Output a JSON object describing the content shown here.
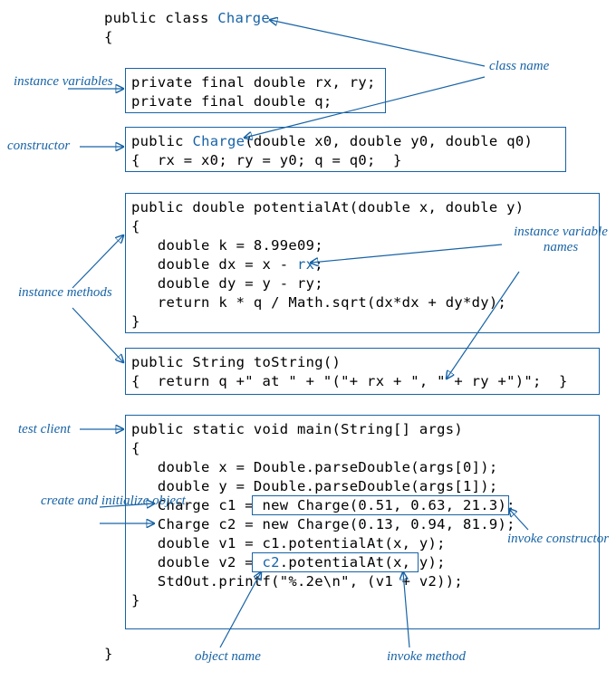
{
  "labels": {
    "class_name": "class\nname",
    "instance_variables": "instance\nvariables",
    "constructor": "constructor",
    "instance_methods": "instance\nmethods",
    "instance_variable_names": "instance\nvariable\nnames",
    "test_client": "test client",
    "create_initialize": "create\nand\ninitialize\nobject",
    "invoke_constructor": "invoke\nconstructor",
    "object_name": "object\nname",
    "invoke_method": "invoke\nmethod"
  },
  "code": {
    "line1a": "public class ",
    "line1b": "Charge",
    "line2": "{",
    "ivar1": "private final double rx, ry;",
    "ivar2": "private final double q;",
    "ctor1a": "public ",
    "ctor1b": "Charge",
    "ctor1c": "(double x0, double y0, double q0)",
    "ctor2": "{  rx = x0; ry = y0; q = q0;  }",
    "pot1": "public double potentialAt(double x, double y)",
    "pot2": "{",
    "pot3": "   double k = 8.99e09;",
    "pot4a": "   double dx = x - ",
    "pot4b": "rx",
    "pot4c": ";",
    "pot5": "   double dy = y - ry;",
    "pot6": "   return k * q / Math.sqrt(dx*dx + dy*dy);",
    "pot7": "}",
    "ts1": "public String toString()",
    "ts2": "{  return q +\" at \" + \"(\"+ rx + \", \" + ry +\")\";  }",
    "main1": "public static void main(String[] args)",
    "main2": "{",
    "main3": "   double x = Double.parseDouble(args[0]);",
    "main4": "   double y = Double.parseDouble(args[1]);",
    "main5": "   Charge c1 = new Charge(0.51, 0.63, 21.3);",
    "main6": "   Charge c2 = new Charge(0.13, 0.94, 81.9);",
    "main7": "   double v1 = c1.potentialAt(x, y);",
    "main8a": "   double v2 = ",
    "main8b": "c2",
    "main8c": ".potentialAt(x, y);",
    "main9": "   StdOut.printf(\"%.2e\\n\", (v1 + v2));",
    "main10": "}",
    "close": "}"
  }
}
